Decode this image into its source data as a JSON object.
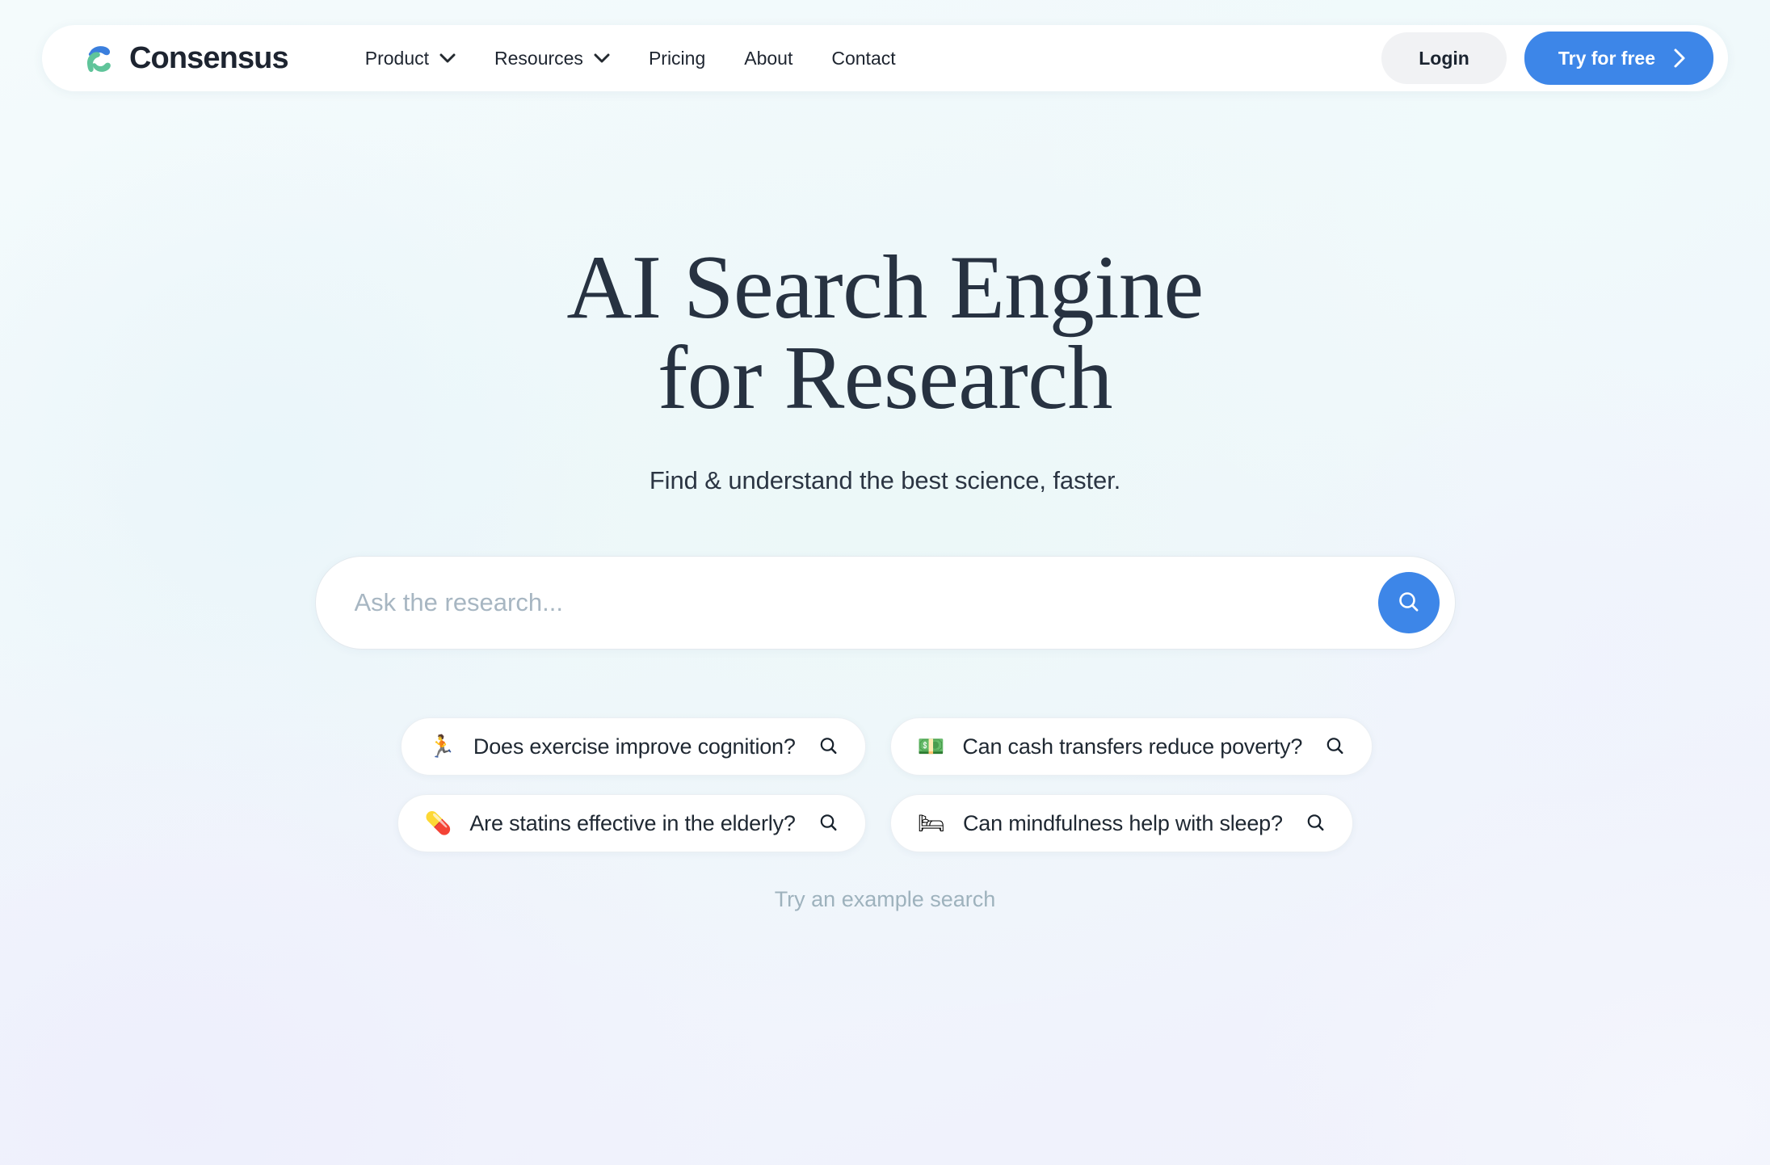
{
  "brand": {
    "name": "Consensus",
    "logo_icon": "consensus-c-logo",
    "logo_blue": "#3b7fdd",
    "logo_green": "#5fc49a"
  },
  "colors": {
    "accent_blue": "#3d86e8",
    "headline": "#273241",
    "muted": "#9eb2bd",
    "login_bg": "#f1f2f4"
  },
  "nav": {
    "items": [
      {
        "label": "Product",
        "has_chevron": true,
        "icon": "chevron-down-icon"
      },
      {
        "label": "Resources",
        "has_chevron": true,
        "icon": "chevron-down-icon"
      },
      {
        "label": "Pricing",
        "has_chevron": false,
        "icon": ""
      },
      {
        "label": "About",
        "has_chevron": false,
        "icon": ""
      },
      {
        "label": "Contact",
        "has_chevron": false,
        "icon": ""
      }
    ],
    "login_label": "Login",
    "cta_label": "Try for free",
    "cta_icon": "chevron-right-icon"
  },
  "hero": {
    "headline_line1": "AI Search Engine",
    "headline_line2": "for Research",
    "subhead": "Find & understand the best science, faster."
  },
  "search": {
    "placeholder": "Ask the research...",
    "value": "",
    "button_icon": "search-icon"
  },
  "examples": {
    "caption": "Try an example search",
    "chips": [
      {
        "emoji": "🏃",
        "emoji_name": "runner-emoji",
        "text": "Does exercise improve cognition?",
        "icon": "search-icon"
      },
      {
        "emoji": "💵",
        "emoji_name": "banknote-emoji",
        "text": "Can cash transfers reduce poverty?",
        "icon": "search-icon"
      },
      {
        "emoji": "💊",
        "emoji_name": "pill-emoji",
        "text": "Are statins effective in the elderly?",
        "icon": "search-icon"
      },
      {
        "emoji": "🛏",
        "emoji_name": "bed-emoji",
        "text": "Can mindfulness help with sleep?",
        "icon": "search-icon"
      }
    ]
  }
}
